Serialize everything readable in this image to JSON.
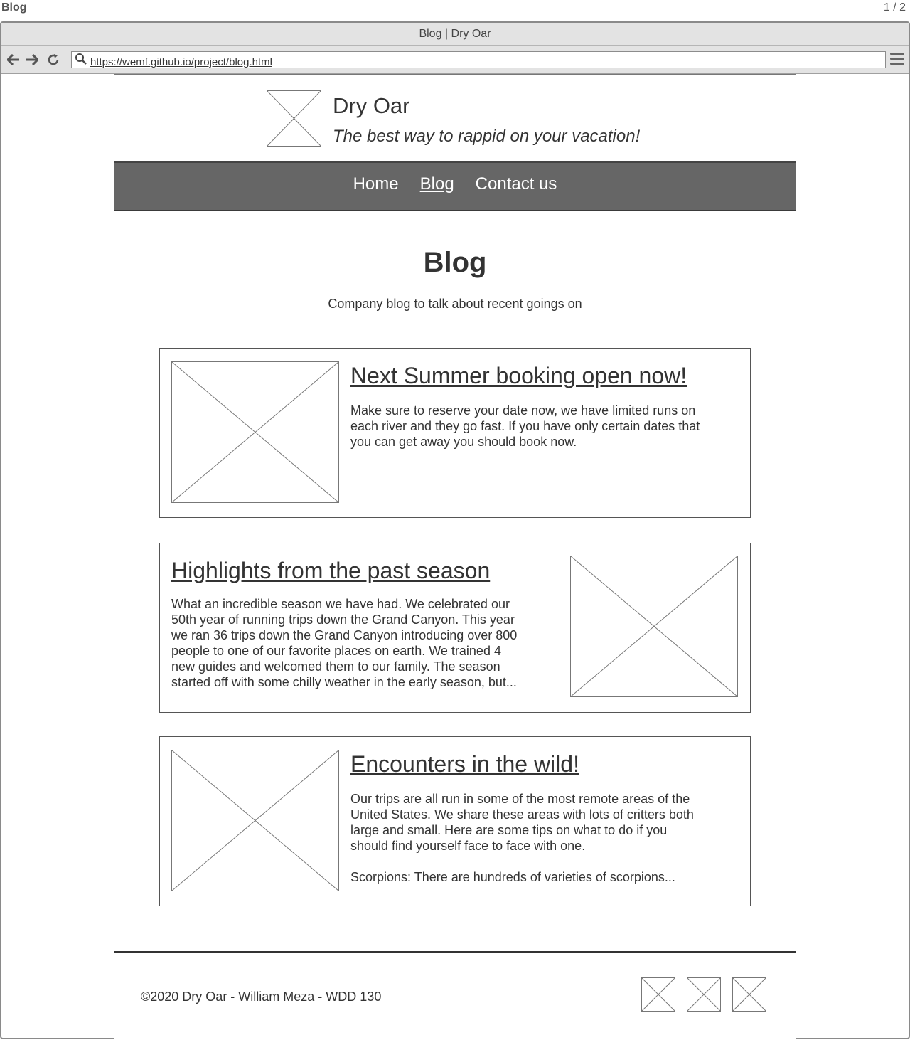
{
  "page_label": "Blog",
  "page_count": "1 / 2",
  "browser": {
    "title": "Blog | Dry Oar",
    "url": "https://wemf.github.io/project/blog.html",
    "back_icon": "arrow-left-icon",
    "forward_icon": "arrow-right-icon",
    "reload_icon": "reload-icon",
    "search_icon": "search-icon",
    "menu_icon": "hamburger-menu-icon"
  },
  "header": {
    "site_name": "Dry Oar",
    "tagline": "The best way to rappid on your vacation!"
  },
  "nav": {
    "items": [
      {
        "label": "Home",
        "active": false
      },
      {
        "label": "Blog",
        "active": true
      },
      {
        "label": "Contact us",
        "active": false
      }
    ]
  },
  "main": {
    "title": "Blog",
    "subtitle": "Company blog to talk about recent goings on"
  },
  "posts": [
    {
      "title": "Next Summer booking open now!",
      "lines": [
        "Make sure to reserve your date now, we have limited runs on",
        "each river and they go fast. If you have only certain dates that",
        "you can get away you should book now."
      ],
      "image_side": "left"
    },
    {
      "title": "Highlights from the past season",
      "lines": [
        "What an incredible season we have had. We celebrated our",
        "50th year of running trips down the Grand Canyon. This year",
        "we ran 36 trips down the Grand Canyon introducing over 800",
        "people to one of our favorite places on earth. We trained 4",
        "new guides and welcomed them to our family. The season",
        "started off with some chilly weather in the early season, but..."
      ],
      "image_side": "right"
    },
    {
      "title": "Encounters in the wild!",
      "lines": [
        "Our trips are all run in some of the most remote areas of the",
        "United States. We share these areas with lots of critters both",
        "large and small. Here are some tips on what to do if you",
        "should find yourself face to face with one.",
        "",
        "Scorpions: There are hundreds of varieties of scorpions..."
      ],
      "image_side": "left"
    }
  ],
  "footer": {
    "text": "©2020 Dry Oar - William Meza - WDD 130"
  }
}
